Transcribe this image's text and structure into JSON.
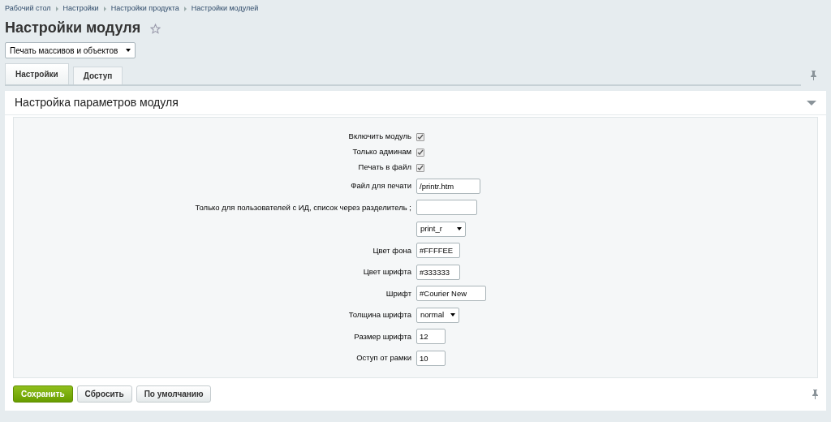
{
  "breadcrumbs": [
    "Рабочий стол",
    "Настройки",
    "Настройки продукта",
    "Настройки модулей"
  ],
  "title": "Настройки модуля",
  "module_select": {
    "value": "Печать массивов и объектов"
  },
  "tabs": [
    {
      "label": "Настройки",
      "selected": true
    },
    {
      "label": "Доступ",
      "selected": false
    }
  ],
  "section": {
    "title": "Настройка параметров модуля",
    "expanded": true
  },
  "fields": [
    {
      "kind": "checkbox",
      "label": "Включить модуль",
      "checked": true
    },
    {
      "kind": "checkbox",
      "label": "Только админам",
      "checked": true
    },
    {
      "kind": "checkbox",
      "label": "Печать в файл",
      "checked": true
    },
    {
      "kind": "text",
      "label": "Файл для печати",
      "value": "/printr.htm"
    },
    {
      "kind": "text",
      "label": "Только для пользователей с ИД, список через разделитель ;"
    },
    {
      "kind": "select",
      "value": "print_r"
    },
    {
      "kind": "text",
      "label": "Цвет фона",
      "value": "#FFFFEE"
    },
    {
      "kind": "text",
      "label": "Цвет шрифта",
      "value": "#333333"
    },
    {
      "kind": "text",
      "label": "Шрифт",
      "value": "#Courier New"
    },
    {
      "kind": "select",
      "label": "Толщина шрифта",
      "value": "normal"
    },
    {
      "kind": "text",
      "label": "Размер шрифта",
      "value": "12"
    },
    {
      "kind": "text",
      "label": "Оступ от рамки",
      "value": "10"
    }
  ],
  "buttons": [
    {
      "label": "Сохранить",
      "kind": "primary"
    },
    {
      "label": "Сбросить",
      "kind": "plain"
    },
    {
      "label": "По умолчанию",
      "kind": "plain"
    }
  ]
}
